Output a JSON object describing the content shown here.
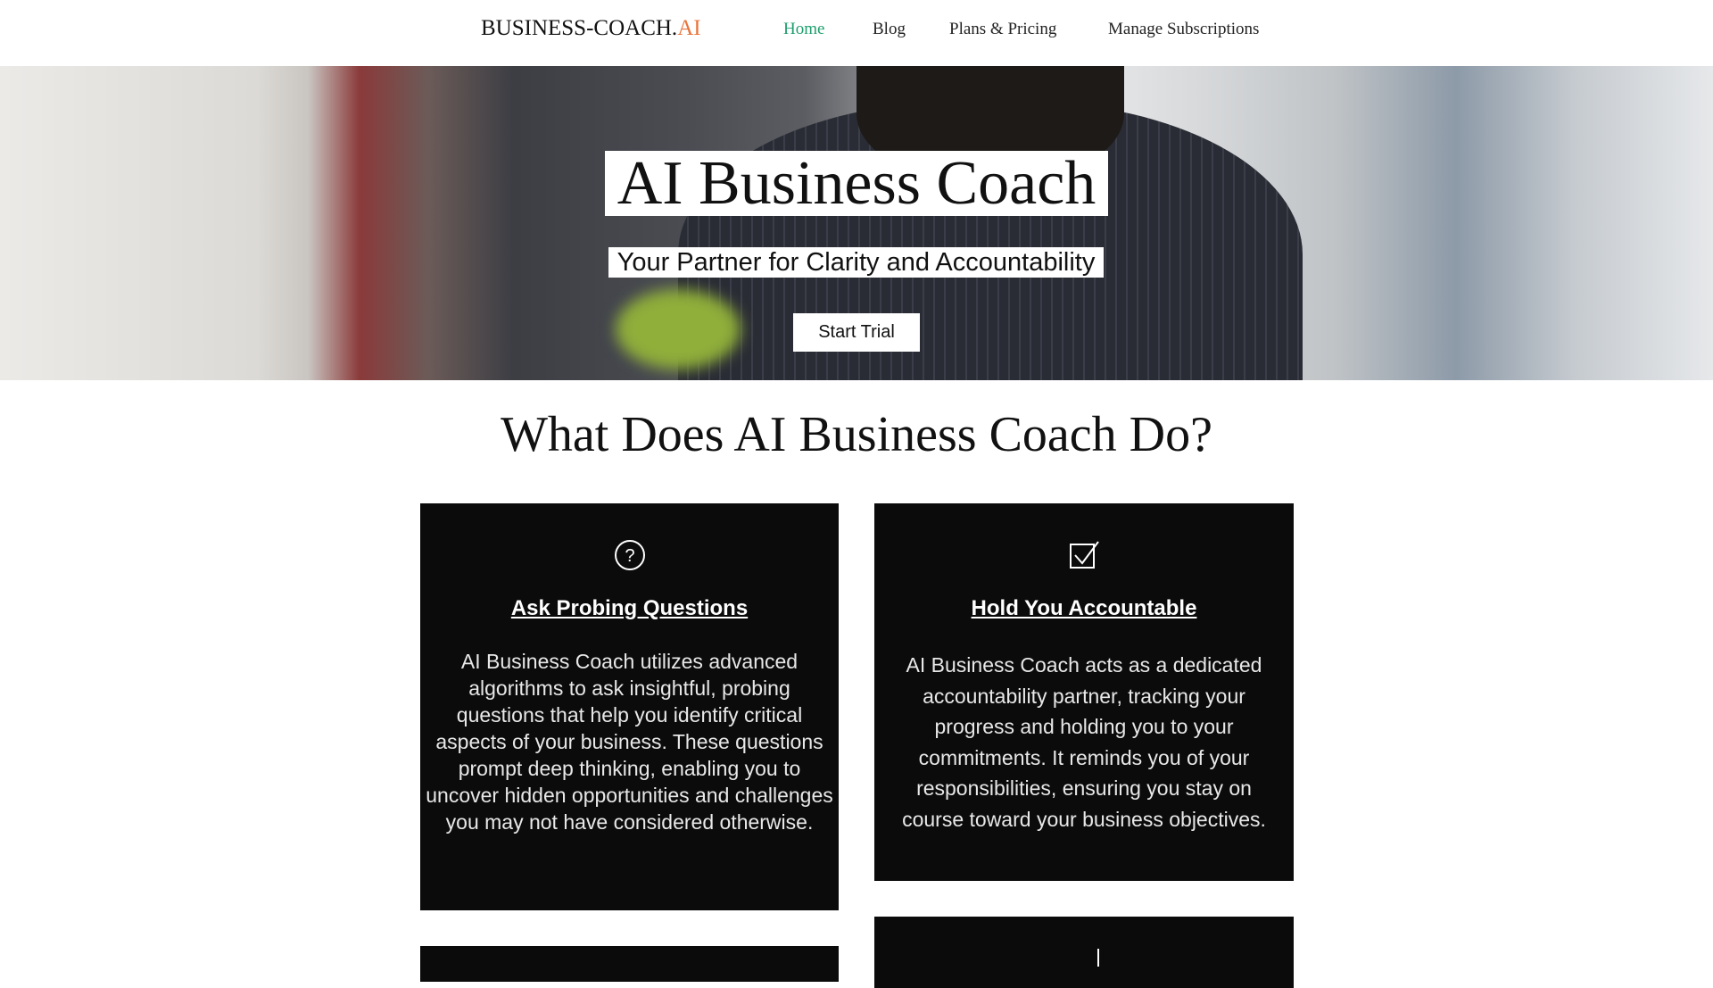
{
  "header": {
    "logo_main": "BUSINESS-COACH.",
    "logo_accent": "AI",
    "nav": [
      "Home",
      "Blog",
      "Plans & Pricing",
      "Manage Subscriptions"
    ],
    "active_nav": "Home",
    "colors": {
      "active": "#1f9e6e",
      "logo_accent": "#e8743b"
    }
  },
  "hero": {
    "title": "AI Business Coach",
    "subtitle": "Your Partner for Clarity and Accountability",
    "cta_label": "Start Trial"
  },
  "section": {
    "title": "What Does AI Business Coach Do?",
    "cards": [
      {
        "icon": "question-circle-icon",
        "title": "Ask Probing Questions",
        "body": "AI Business Coach utilizes advanced algorithms to ask insightful, probing questions that help you identify critical aspects of your business. These questions prompt deep thinking, enabling you to uncover hidden opportunities and challenges you may not have considered otherwise."
      },
      {
        "icon": "checkbox-icon",
        "title": "Hold You Accountable",
        "body": "AI Business Coach acts as a dedicated accountability partner, tracking your progress and holding you to your commitments. It reminds you of your responsibilities, ensuring you stay on course toward your business objectives."
      }
    ]
  }
}
